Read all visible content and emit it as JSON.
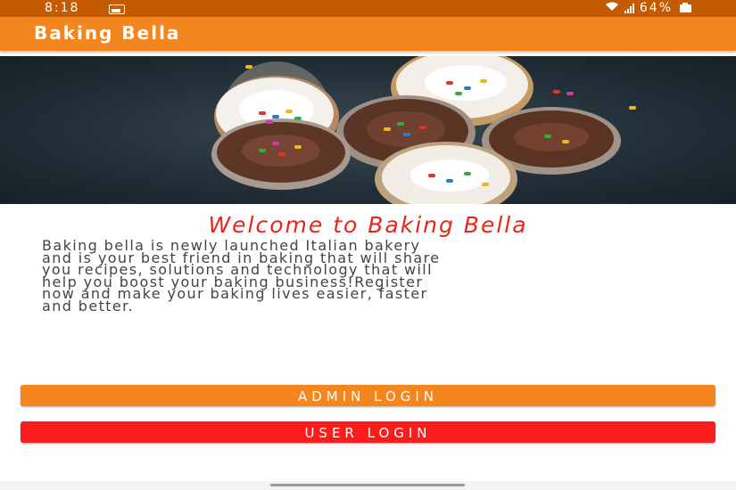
{
  "status_bar": {
    "time": "8:18",
    "battery": "64%",
    "icons": [
      "image-icon",
      "wifi-icon",
      "signal-icon",
      "battery-icon"
    ]
  },
  "app_bar": {
    "title": "Baking Bella",
    "color": "#f3861e"
  },
  "hero": {
    "image": "cupcakes-banner"
  },
  "main": {
    "welcome_title": "Welcome to Baking Bella",
    "description_lines": [
      "Baking bella is newly launched Italian bakery",
      "and is your best friend in baking that will share",
      "you recipes, solutions and technology that will",
      "help you boost your baking business!Register",
      "now and make your baking lives easier, faster",
      "and better."
    ]
  },
  "buttons": {
    "admin_login": "ADMIN LOGIN",
    "user_login": "USER LOGIN",
    "admin_color": "#f4861d",
    "user_color": "#fb1d1d"
  }
}
